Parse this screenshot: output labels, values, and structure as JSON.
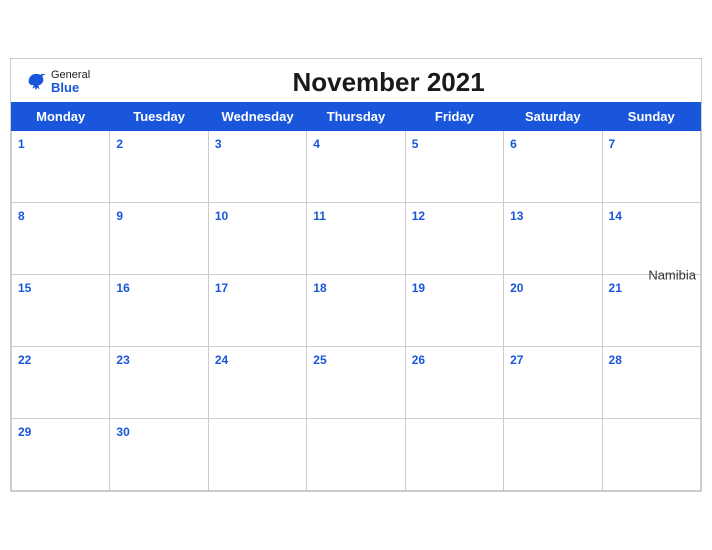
{
  "header": {
    "title": "November 2021",
    "country": "Namibia",
    "logo": {
      "general": "General",
      "blue": "Blue"
    }
  },
  "weekdays": [
    "Monday",
    "Tuesday",
    "Wednesday",
    "Thursday",
    "Friday",
    "Saturday",
    "Sunday"
  ],
  "weeks": [
    [
      1,
      2,
      3,
      4,
      5,
      6,
      7
    ],
    [
      8,
      9,
      10,
      11,
      12,
      13,
      14
    ],
    [
      15,
      16,
      17,
      18,
      19,
      20,
      21
    ],
    [
      22,
      23,
      24,
      25,
      26,
      27,
      28
    ],
    [
      29,
      30,
      null,
      null,
      null,
      null,
      null
    ]
  ],
  "colors": {
    "header_bg": "#1a56db",
    "day_number": "#1a56db"
  }
}
